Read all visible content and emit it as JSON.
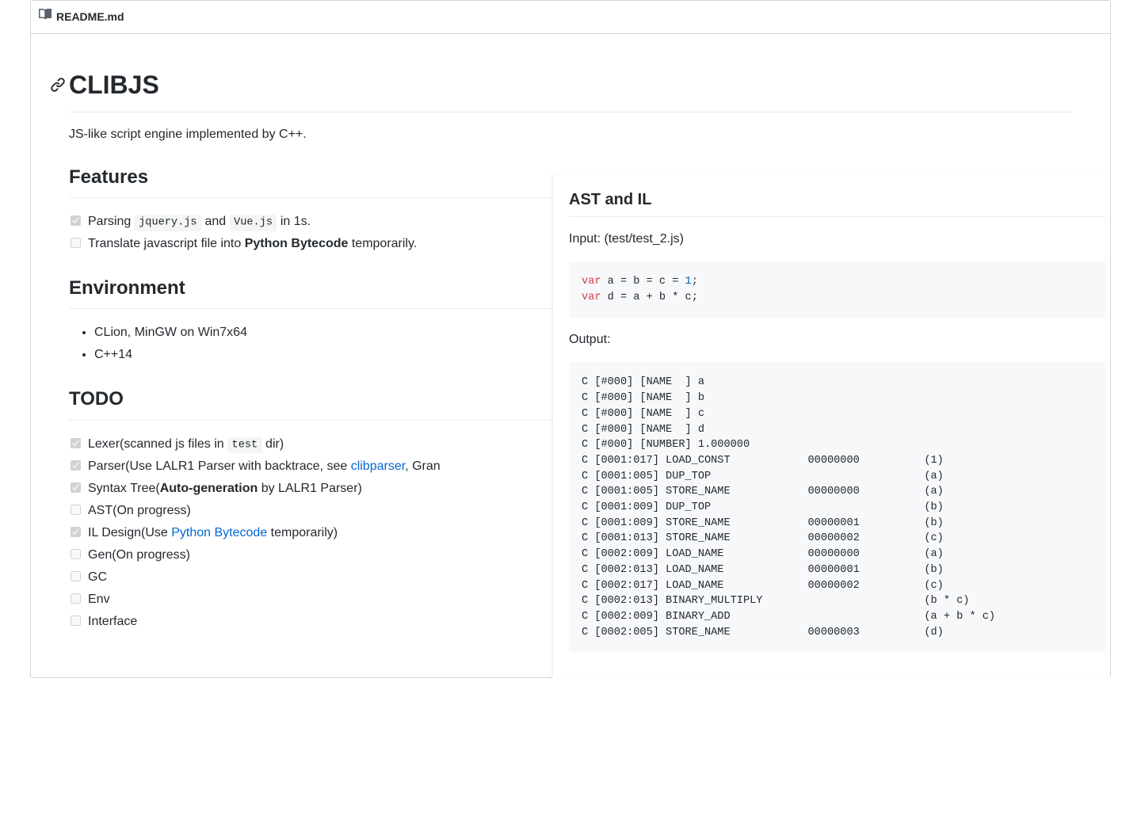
{
  "header": {
    "filename": "README.md"
  },
  "title": "CLIBJS",
  "subtitle": "JS-like script engine implemented by C++.",
  "sections": {
    "features": {
      "heading": "Features",
      "items": [
        {
          "checked": true,
          "pre": "Parsing ",
          "code1": "jquery.js",
          "mid": " and ",
          "code2": "Vue.js",
          "post": " in 1s."
        },
        {
          "checked": false,
          "pre": "Translate javascript file into ",
          "strong": "Python Bytecode",
          "post": " temporarily."
        }
      ]
    },
    "environment": {
      "heading": "Environment",
      "items": [
        "CLion, MinGW on Win7x64",
        "C++14"
      ]
    },
    "todo": {
      "heading": "TODO",
      "items": [
        {
          "checked": true,
          "pre": "Lexer(scanned js files in ",
          "code": "test",
          "post": " dir)"
        },
        {
          "checked": true,
          "pre": "Parser(Use LALR1 Parser with backtrace, see ",
          "link": "clibparser",
          "post": ", Gran"
        },
        {
          "checked": true,
          "pre": "Syntax Tree(",
          "strong": "Auto-generation",
          "post": " by LALR1 Parser)"
        },
        {
          "checked": false,
          "text": "AST(On progress)"
        },
        {
          "checked": true,
          "pre": "IL Design(Use ",
          "link": "Python Bytecode",
          "post": " temporarily)"
        },
        {
          "checked": false,
          "text": "Gen(On progress)"
        },
        {
          "checked": false,
          "text": "GC"
        },
        {
          "checked": false,
          "text": "Env"
        },
        {
          "checked": false,
          "text": "Interface"
        }
      ]
    }
  },
  "right": {
    "heading": "AST and IL",
    "input_label": "Input: (test/test_2.js)",
    "input_code": {
      "l1": {
        "kw": "var",
        "rest": " a = b = c = ",
        "num": "1",
        "tail": ";"
      },
      "l2": {
        "kw": "var",
        "rest": " d = a + b * c;"
      }
    },
    "output_label": "Output:",
    "output_lines": [
      "C [#000] [NAME  ] a",
      "C [#000] [NAME  ] b",
      "C [#000] [NAME  ] c",
      "C [#000] [NAME  ] d",
      "C [#000] [NUMBER] 1.000000",
      "C [0001:017] LOAD_CONST            00000000          (1)",
      "C [0001:005] DUP_TOP                                 (a)",
      "C [0001:005] STORE_NAME            00000000          (a)",
      "C [0001:009] DUP_TOP                                 (b)",
      "C [0001:009] STORE_NAME            00000001          (b)",
      "C [0001:013] STORE_NAME            00000002          (c)",
      "C [0002:009] LOAD_NAME             00000000          (a)",
      "C [0002:013] LOAD_NAME             00000001          (b)",
      "C [0002:017] LOAD_NAME             00000002          (c)",
      "C [0002:013] BINARY_MULTIPLY                         (b * c)",
      "C [0002:009] BINARY_ADD                              (a + b * c)",
      "C [0002:005] STORE_NAME            00000003          (d)"
    ]
  }
}
